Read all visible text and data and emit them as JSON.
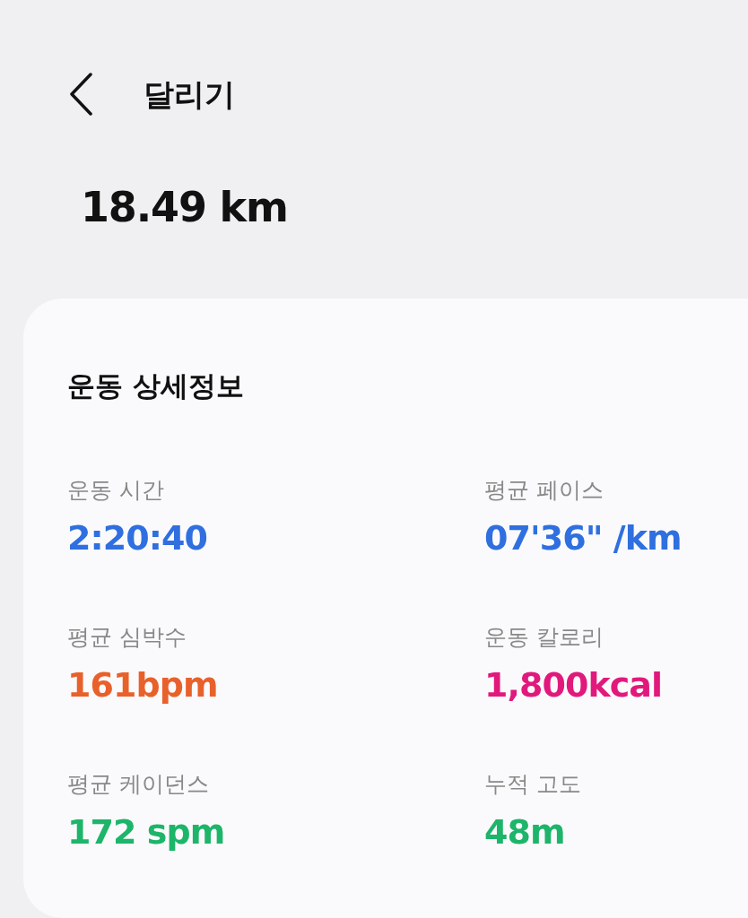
{
  "header": {
    "title": "달리기"
  },
  "distance": "18.49 km",
  "details": {
    "title": "운동 상세정보",
    "stats": [
      {
        "label": "운동 시간",
        "value": "2:20:40",
        "color": "#2f6fdf"
      },
      {
        "label": "평균 페이스",
        "value": "07'36\" /km",
        "color": "#2f6fdf"
      },
      {
        "label": "평균 심박수",
        "value": "161bpm",
        "color": "#e8612b"
      },
      {
        "label": "운동 칼로리",
        "value": "1,800kcal",
        "color": "#e2197c"
      },
      {
        "label": "평균 케이던스",
        "value": "172 spm",
        "color": "#1db56a"
      },
      {
        "label": "누적 고도",
        "value": "48m",
        "color": "#1db56a"
      }
    ]
  }
}
